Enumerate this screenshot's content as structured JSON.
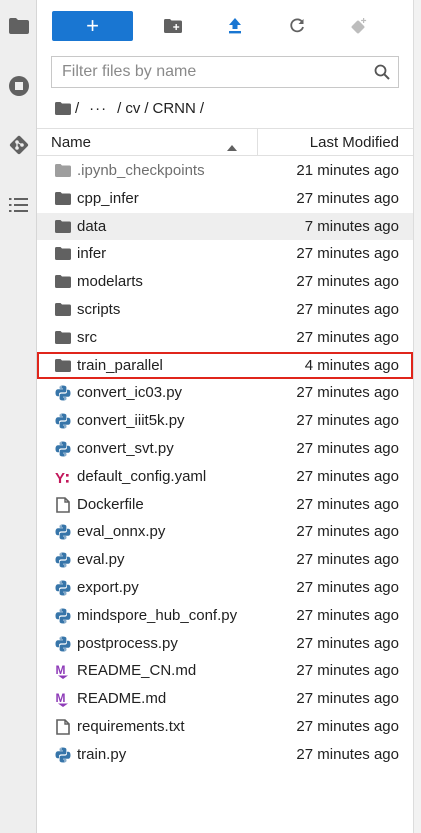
{
  "toolbar": {
    "new_launcher_label": "+",
    "icons": [
      "new-folder-icon",
      "upload-icon",
      "refresh-icon",
      "git-clone-icon"
    ]
  },
  "rail": {
    "icons": [
      "folder-icon",
      "running-icon",
      "git-icon",
      "table-of-contents-icon"
    ]
  },
  "filter": {
    "placeholder": "Filter files by name"
  },
  "breadcrumbs": {
    "root_sep": "/",
    "ellipsis": "···",
    "parts": [
      "cv",
      "CRNN"
    ]
  },
  "header": {
    "name": "Name",
    "modified": "Last Modified"
  },
  "files": [
    {
      "name": ".ipynb_checkpoints",
      "modified": "21 minutes ago",
      "type": "folder"
    },
    {
      "name": "cpp_infer",
      "modified": "27 minutes ago",
      "type": "folder"
    },
    {
      "name": "data",
      "modified": "7 minutes ago",
      "type": "folder"
    },
    {
      "name": "infer",
      "modified": "27 minutes ago",
      "type": "folder"
    },
    {
      "name": "modelarts",
      "modified": "27 minutes ago",
      "type": "folder"
    },
    {
      "name": "scripts",
      "modified": "27 minutes ago",
      "type": "folder"
    },
    {
      "name": "src",
      "modified": "27 minutes ago",
      "type": "folder"
    },
    {
      "name": "train_parallel",
      "modified": "4 minutes ago",
      "type": "folder"
    },
    {
      "name": "convert_ic03.py",
      "modified": "27 minutes ago",
      "type": "python"
    },
    {
      "name": "convert_iiit5k.py",
      "modified": "27 minutes ago",
      "type": "python"
    },
    {
      "name": "convert_svt.py",
      "modified": "27 minutes ago",
      "type": "python"
    },
    {
      "name": "default_config.yaml",
      "modified": "27 minutes ago",
      "type": "yaml"
    },
    {
      "name": "Dockerfile",
      "modified": "27 minutes ago",
      "type": "file"
    },
    {
      "name": "eval_onnx.py",
      "modified": "27 minutes ago",
      "type": "python"
    },
    {
      "name": "eval.py",
      "modified": "27 minutes ago",
      "type": "python"
    },
    {
      "name": "export.py",
      "modified": "27 minutes ago",
      "type": "python"
    },
    {
      "name": "mindspore_hub_conf.py",
      "modified": "27 minutes ago",
      "type": "python"
    },
    {
      "name": "postprocess.py",
      "modified": "27 minutes ago",
      "type": "python"
    },
    {
      "name": "README_CN.md",
      "modified": "27 minutes ago",
      "type": "markdown"
    },
    {
      "name": "README.md",
      "modified": "27 minutes ago",
      "type": "markdown"
    },
    {
      "name": "requirements.txt",
      "modified": "27 minutes ago",
      "type": "file"
    },
    {
      "name": "train.py",
      "modified": "27 minutes ago",
      "type": "python"
    }
  ],
  "selected_file": "data",
  "highlighted_file": "train_parallel",
  "colors": {
    "accent": "#1976d2",
    "highlight_border": "#e0251b",
    "python_blue": "#3775a9",
    "python_yellow": "#f7cf2b",
    "markdown": "#8e3bb8",
    "yaml": "#c2185b",
    "icon_gray": "#616161"
  }
}
